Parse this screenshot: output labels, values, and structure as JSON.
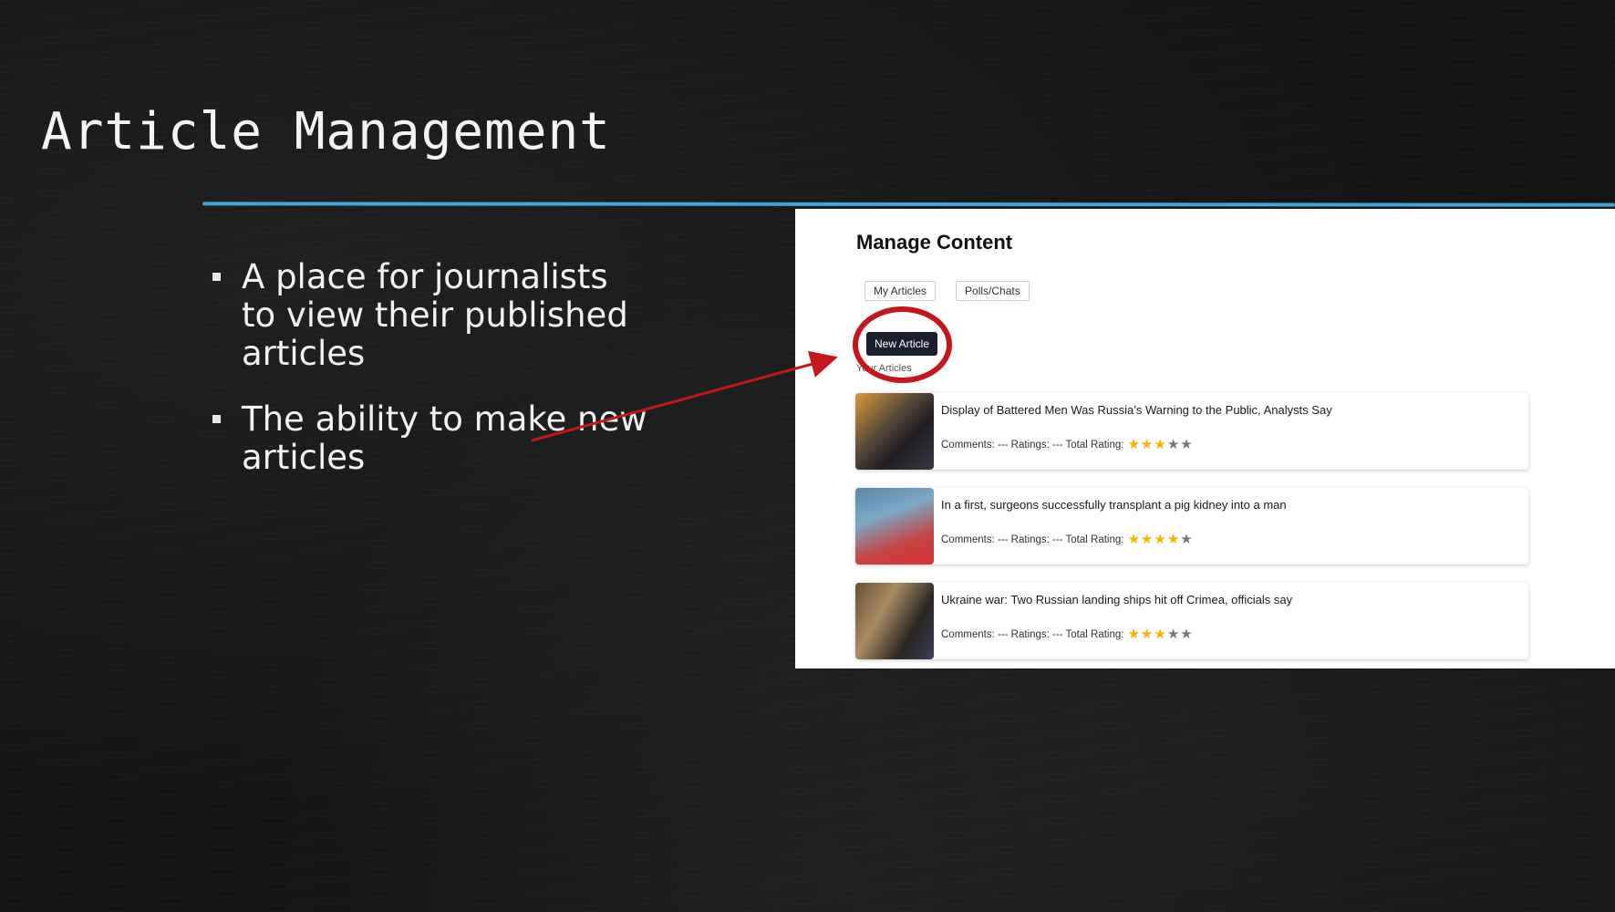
{
  "slide": {
    "title": "Article Management",
    "bullets": [
      "A place for journalists to view their published articles",
      "The ability to make new articles"
    ]
  },
  "panel": {
    "title": "Manage Content",
    "tabs": [
      "My Articles",
      "Polls/Chats"
    ],
    "new_article_label": "New Article",
    "section_label": "Your Articles",
    "articles": [
      {
        "title": "Display of Battered Men Was Russia’s Warning to the Public, Analysts Say",
        "meta": "Comments: --- Ratings: --- Total Rating:",
        "rating": 3
      },
      {
        "title": "In a first, surgeons successfully transplant a pig kidney into a man",
        "meta": "Comments: --- Ratings: --- Total Rating:",
        "rating": 4
      },
      {
        "title": "Ukraine war: Two Russian landing ships hit off Crimea, officials say",
        "meta": "Comments: --- Ratings: --- Total Rating:",
        "rating": 3
      }
    ],
    "max_rating": 5
  },
  "colors": {
    "accent_rule": "#3fa6d8",
    "highlight": "#c4161c",
    "star_filled": "#f4b400",
    "star_empty": "#777777",
    "button_bg": "#1a1f2e"
  }
}
